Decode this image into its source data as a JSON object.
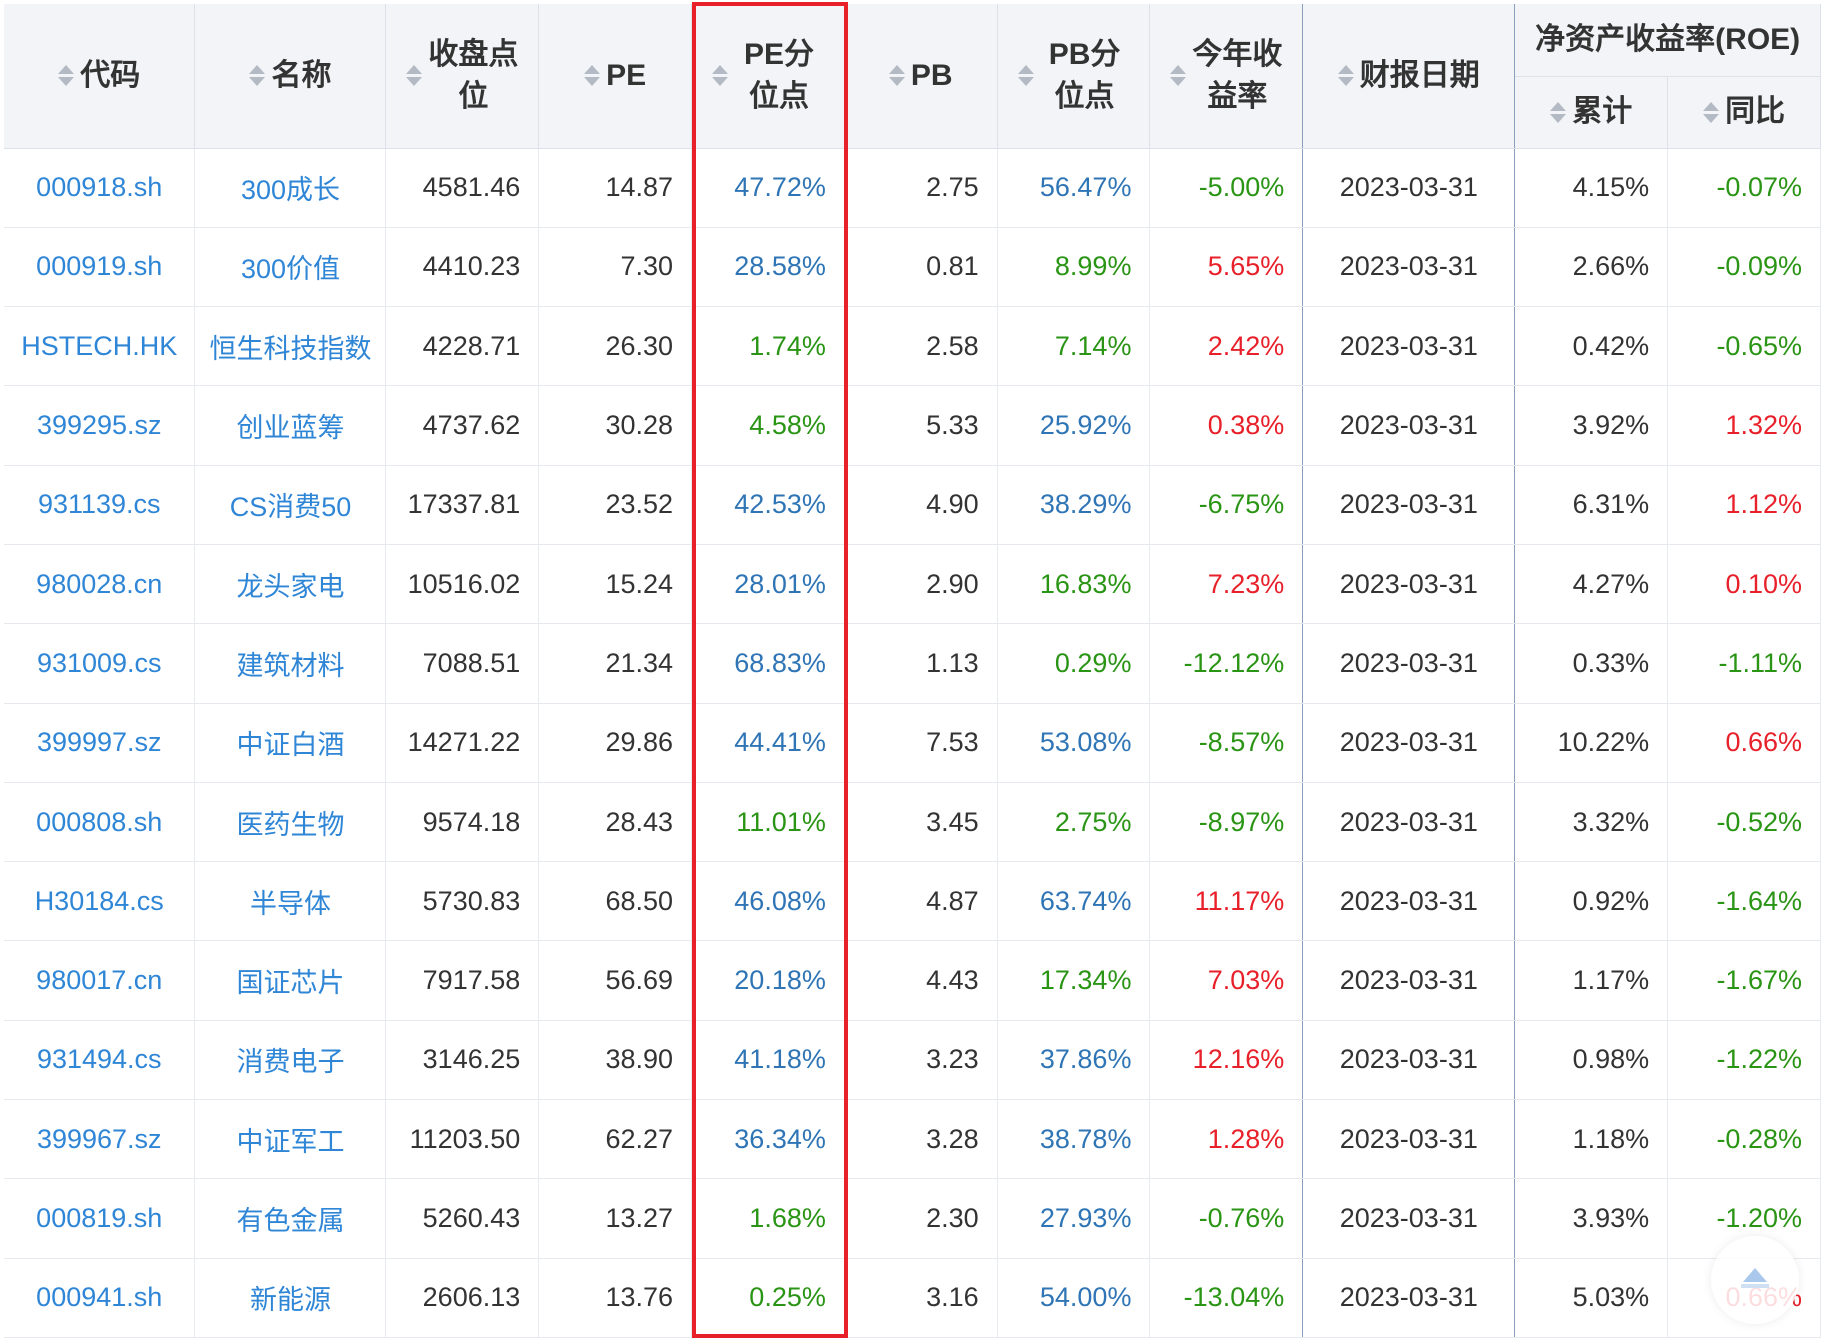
{
  "headers": {
    "code": "代码",
    "name": "名称",
    "close": "收盘点位",
    "pe": "PE",
    "pe_pct": "PE分位点",
    "pb": "PB",
    "pb_pct": "PB分位点",
    "ytd": "今年收益率",
    "report_date": "财报日期",
    "roe": "净资产收益率(ROE)",
    "roe_cum": "累计",
    "roe_yoy": "同比"
  },
  "colors": {
    "link": "#2f86d6",
    "blue": "#2f75b5",
    "green": "#2a9415",
    "red": "#e8202a",
    "highlight_border": "#e8202a"
  },
  "rows": [
    {
      "code": "000918.sh",
      "name": "300成长",
      "close": "4581.46",
      "pe": "14.87",
      "pe_pct": "47.72%",
      "pe_pct_color": "blue",
      "pb": "2.75",
      "pb_pct": "56.47%",
      "pb_pct_color": "blue",
      "ytd": "-5.00%",
      "ytd_color": "green",
      "date": "2023-03-31",
      "roe_cum": "4.15%",
      "roe_yoy": "-0.07%",
      "roe_yoy_color": "green"
    },
    {
      "code": "000919.sh",
      "name": "300价值",
      "close": "4410.23",
      "pe": "7.30",
      "pe_pct": "28.58%",
      "pe_pct_color": "blue",
      "pb": "0.81",
      "pb_pct": "8.99%",
      "pb_pct_color": "green",
      "ytd": "5.65%",
      "ytd_color": "red",
      "date": "2023-03-31",
      "roe_cum": "2.66%",
      "roe_yoy": "-0.09%",
      "roe_yoy_color": "green"
    },
    {
      "code": "HSTECH.HK",
      "name": "恒生科技指数",
      "close": "4228.71",
      "pe": "26.30",
      "pe_pct": "1.74%",
      "pe_pct_color": "green",
      "pb": "2.58",
      "pb_pct": "7.14%",
      "pb_pct_color": "green",
      "ytd": "2.42%",
      "ytd_color": "red",
      "date": "2023-03-31",
      "roe_cum": "0.42%",
      "roe_yoy": "-0.65%",
      "roe_yoy_color": "green"
    },
    {
      "code": "399295.sz",
      "name": "创业蓝筹",
      "close": "4737.62",
      "pe": "30.28",
      "pe_pct": "4.58%",
      "pe_pct_color": "green",
      "pb": "5.33",
      "pb_pct": "25.92%",
      "pb_pct_color": "blue",
      "ytd": "0.38%",
      "ytd_color": "red",
      "date": "2023-03-31",
      "roe_cum": "3.92%",
      "roe_yoy": "1.32%",
      "roe_yoy_color": "red"
    },
    {
      "code": "931139.cs",
      "name": "CS消费50",
      "close": "17337.81",
      "pe": "23.52",
      "pe_pct": "42.53%",
      "pe_pct_color": "blue",
      "pb": "4.90",
      "pb_pct": "38.29%",
      "pb_pct_color": "blue",
      "ytd": "-6.75%",
      "ytd_color": "green",
      "date": "2023-03-31",
      "roe_cum": "6.31%",
      "roe_yoy": "1.12%",
      "roe_yoy_color": "red"
    },
    {
      "code": "980028.cn",
      "name": "龙头家电",
      "close": "10516.02",
      "pe": "15.24",
      "pe_pct": "28.01%",
      "pe_pct_color": "blue",
      "pb": "2.90",
      "pb_pct": "16.83%",
      "pb_pct_color": "green",
      "ytd": "7.23%",
      "ytd_color": "red",
      "date": "2023-03-31",
      "roe_cum": "4.27%",
      "roe_yoy": "0.10%",
      "roe_yoy_color": "red"
    },
    {
      "code": "931009.cs",
      "name": "建筑材料",
      "close": "7088.51",
      "pe": "21.34",
      "pe_pct": "68.83%",
      "pe_pct_color": "blue",
      "pb": "1.13",
      "pb_pct": "0.29%",
      "pb_pct_color": "green",
      "ytd": "-12.12%",
      "ytd_color": "green",
      "date": "2023-03-31",
      "roe_cum": "0.33%",
      "roe_yoy": "-1.11%",
      "roe_yoy_color": "green"
    },
    {
      "code": "399997.sz",
      "name": "中证白酒",
      "close": "14271.22",
      "pe": "29.86",
      "pe_pct": "44.41%",
      "pe_pct_color": "blue",
      "pb": "7.53",
      "pb_pct": "53.08%",
      "pb_pct_color": "blue",
      "ytd": "-8.57%",
      "ytd_color": "green",
      "date": "2023-03-31",
      "roe_cum": "10.22%",
      "roe_yoy": "0.66%",
      "roe_yoy_color": "red"
    },
    {
      "code": "000808.sh",
      "name": "医药生物",
      "close": "9574.18",
      "pe": "28.43",
      "pe_pct": "11.01%",
      "pe_pct_color": "green",
      "pb": "3.45",
      "pb_pct": "2.75%",
      "pb_pct_color": "green",
      "ytd": "-8.97%",
      "ytd_color": "green",
      "date": "2023-03-31",
      "roe_cum": "3.32%",
      "roe_yoy": "-0.52%",
      "roe_yoy_color": "green"
    },
    {
      "code": "H30184.cs",
      "name": "半导体",
      "close": "5730.83",
      "pe": "68.50",
      "pe_pct": "46.08%",
      "pe_pct_color": "blue",
      "pb": "4.87",
      "pb_pct": "63.74%",
      "pb_pct_color": "blue",
      "ytd": "11.17%",
      "ytd_color": "red",
      "date": "2023-03-31",
      "roe_cum": "0.92%",
      "roe_yoy": "-1.64%",
      "roe_yoy_color": "green"
    },
    {
      "code": "980017.cn",
      "name": "国证芯片",
      "close": "7917.58",
      "pe": "56.69",
      "pe_pct": "20.18%",
      "pe_pct_color": "blue",
      "pb": "4.43",
      "pb_pct": "17.34%",
      "pb_pct_color": "green",
      "ytd": "7.03%",
      "ytd_color": "red",
      "date": "2023-03-31",
      "roe_cum": "1.17%",
      "roe_yoy": "-1.67%",
      "roe_yoy_color": "green"
    },
    {
      "code": "931494.cs",
      "name": "消费电子",
      "close": "3146.25",
      "pe": "38.90",
      "pe_pct": "41.18%",
      "pe_pct_color": "blue",
      "pb": "3.23",
      "pb_pct": "37.86%",
      "pb_pct_color": "blue",
      "ytd": "12.16%",
      "ytd_color": "red",
      "date": "2023-03-31",
      "roe_cum": "0.98%",
      "roe_yoy": "-1.22%",
      "roe_yoy_color": "green"
    },
    {
      "code": "399967.sz",
      "name": "中证军工",
      "close": "11203.50",
      "pe": "62.27",
      "pe_pct": "36.34%",
      "pe_pct_color": "blue",
      "pb": "3.28",
      "pb_pct": "38.78%",
      "pb_pct_color": "blue",
      "ytd": "1.28%",
      "ytd_color": "red",
      "date": "2023-03-31",
      "roe_cum": "1.18%",
      "roe_yoy": "-0.28%",
      "roe_yoy_color": "green"
    },
    {
      "code": "000819.sh",
      "name": "有色金属",
      "close": "5260.43",
      "pe": "13.27",
      "pe_pct": "1.68%",
      "pe_pct_color": "green",
      "pb": "2.30",
      "pb_pct": "27.93%",
      "pb_pct_color": "blue",
      "ytd": "-0.76%",
      "ytd_color": "green",
      "date": "2023-03-31",
      "roe_cum": "3.93%",
      "roe_yoy": "-1.20%",
      "roe_yoy_color": "green"
    },
    {
      "code": "000941.sh",
      "name": "新能源",
      "close": "2606.13",
      "pe": "13.76",
      "pe_pct": "0.25%",
      "pe_pct_color": "green",
      "pb": "3.16",
      "pb_pct": "54.00%",
      "pb_pct_color": "blue",
      "ytd": "-13.04%",
      "ytd_color": "green",
      "date": "2023-03-31",
      "roe_cum": "5.03%",
      "roe_yoy": "0.66%",
      "roe_yoy_color": "red"
    }
  ],
  "back_to_top_icon": "arrow-up-icon"
}
